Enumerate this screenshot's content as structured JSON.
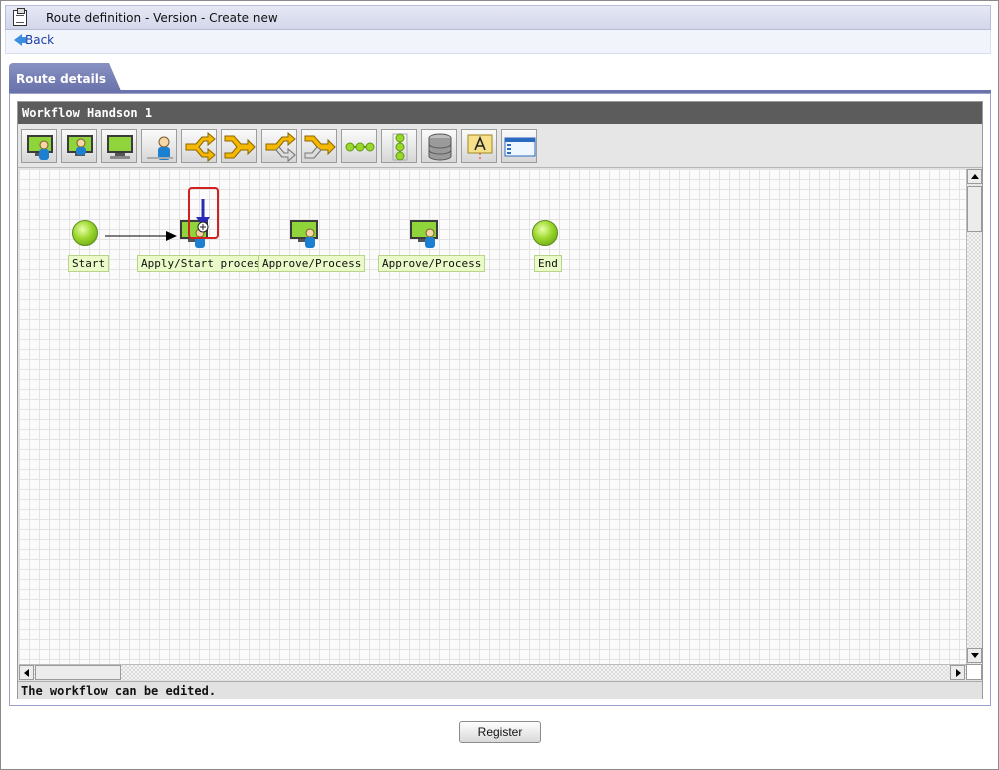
{
  "header": {
    "title": "Route definition - Version - Create new"
  },
  "nav": {
    "back_label": "Back"
  },
  "tabs": [
    {
      "label": "Route details",
      "active": true
    }
  ],
  "workflow": {
    "name": "Workflow Handson 1"
  },
  "toolbar": {
    "tools": [
      {
        "icon": "process-node-icon"
      },
      {
        "icon": "process-node-alt-icon"
      },
      {
        "icon": "monitor-node-icon"
      },
      {
        "icon": "user-node-icon"
      },
      {
        "icon": "branch-icon"
      },
      {
        "icon": "merge-icon"
      },
      {
        "icon": "branch-alt-icon"
      },
      {
        "icon": "merge-alt-icon"
      },
      {
        "icon": "horizontal-chain-icon"
      },
      {
        "icon": "vertical-chain-icon"
      },
      {
        "icon": "database-icon"
      },
      {
        "icon": "text-annotation-icon"
      },
      {
        "icon": "window-icon"
      }
    ]
  },
  "nodes": [
    {
      "label": "Start"
    },
    {
      "label": "Apply/Start process"
    },
    {
      "label": "Approve/Process"
    },
    {
      "label": "Approve/Process"
    },
    {
      "label": "End"
    }
  ],
  "status": {
    "message": "The workflow can be edited."
  },
  "actions": {
    "register_label": "Register"
  },
  "colors": {
    "tab": "#6a73ab",
    "node_label_bg": "#eafac8",
    "highlight": "#d21f1f",
    "insert_arrow": "#2a2ab8"
  }
}
